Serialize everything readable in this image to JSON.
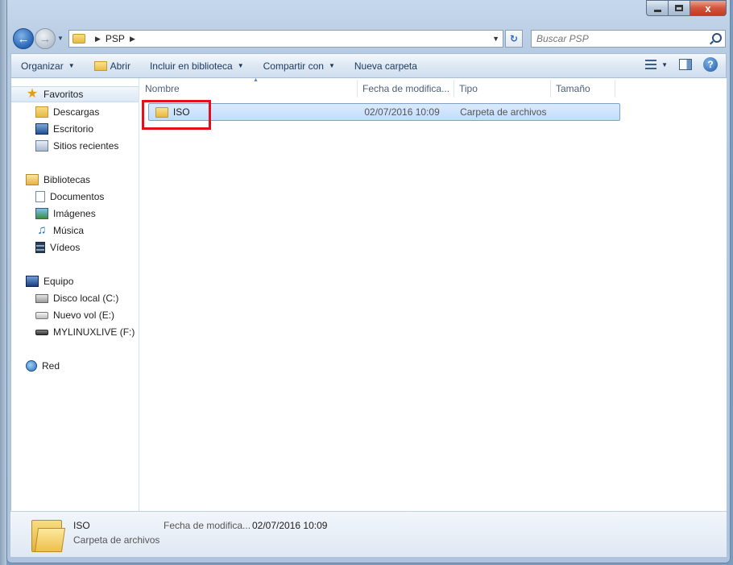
{
  "window": {
    "close_label": "x",
    "min_label": "",
    "max_label": ""
  },
  "address": {
    "path": [
      "PSP"
    ]
  },
  "search": {
    "placeholder": "Buscar PSP"
  },
  "toolbar": {
    "organize": "Organizar",
    "open": "Abrir",
    "include_library": "Incluir en biblioteca",
    "share": "Compartir con",
    "new_folder": "Nueva carpeta"
  },
  "nav": {
    "favorites": {
      "label": "Favoritos",
      "items": [
        "Descargas",
        "Escritorio",
        "Sitios recientes"
      ]
    },
    "libraries": {
      "label": "Bibliotecas",
      "items": [
        "Documentos",
        "Imágenes",
        "Música",
        "Vídeos"
      ]
    },
    "computer": {
      "label": "Equipo",
      "items": [
        "Disco local (C:)",
        "Nuevo vol (E:)",
        "MYLINUXLIVE (F:)"
      ]
    },
    "network": {
      "label": "Red"
    }
  },
  "columns": {
    "name": "Nombre",
    "date": "Fecha de modifica...",
    "type": "Tipo",
    "size": "Tamaño"
  },
  "files": [
    {
      "name": "ISO",
      "date": "02/07/2016 10:09",
      "type": "Carpeta de archivos",
      "size": ""
    }
  ],
  "details": {
    "name": "ISO",
    "type": "Carpeta de archivos",
    "date_label": "Fecha de modifica...",
    "date_value": "02/07/2016 10:09"
  },
  "colors": {
    "selection": "#c1dcfc",
    "highlight_box": "#e3101a"
  }
}
